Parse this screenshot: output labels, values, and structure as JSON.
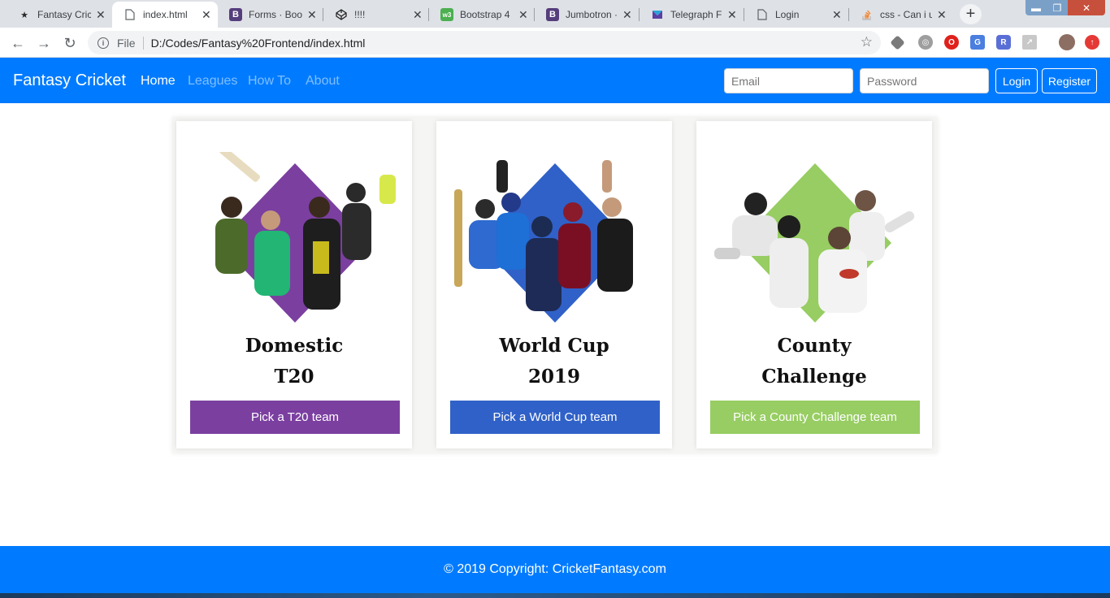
{
  "browser": {
    "tabs": [
      {
        "label": "Fantasy Cric",
        "icon": "fantasy-favicon-icon",
        "active": false
      },
      {
        "label": "index.html",
        "icon": "file-icon",
        "active": true
      },
      {
        "label": "Forms · Boot",
        "icon": "bootstrap-icon",
        "active": false
      },
      {
        "label": "!!!!",
        "icon": "codepen-icon",
        "active": false
      },
      {
        "label": "Bootstrap 4",
        "icon": "w3schools-icon",
        "active": false
      },
      {
        "label": "Jumbotron ·",
        "icon": "bootstrap-icon",
        "active": false
      },
      {
        "label": "Telegraph F",
        "icon": "telegraph-icon",
        "active": false
      },
      {
        "label": "Login",
        "icon": "file-icon",
        "active": false
      },
      {
        "label": "css - Can i u",
        "icon": "stackoverflow-icon",
        "active": false
      }
    ],
    "address": {
      "scheme_label": "File",
      "url": "D:/Codes/Fantasy%20Frontend/index.html"
    }
  },
  "nav": {
    "brand": "Fantasy Cricket",
    "links": [
      "Home",
      "Leagues",
      "How To",
      "About"
    ],
    "active_link": "Home",
    "email_placeholder": "Email",
    "password_placeholder": "Password",
    "login_label": "Login",
    "register_label": "Register",
    "color": "#007bff"
  },
  "cards": [
    {
      "title_line1": "Domestic",
      "title_line2": "T20",
      "button": "Pick a T20 team",
      "accent": "#7b3fa0"
    },
    {
      "title_line1": "World Cup",
      "title_line2": "2019",
      "button": "Pick a World Cup team",
      "accent": "#3061c8"
    },
    {
      "title_line1": "County",
      "title_line2": "Challenge",
      "button": "Pick a County Challenge team",
      "accent": "#97cd62"
    }
  ],
  "footer": {
    "text": "© 2019 Copyright: CricketFantasy.com"
  }
}
